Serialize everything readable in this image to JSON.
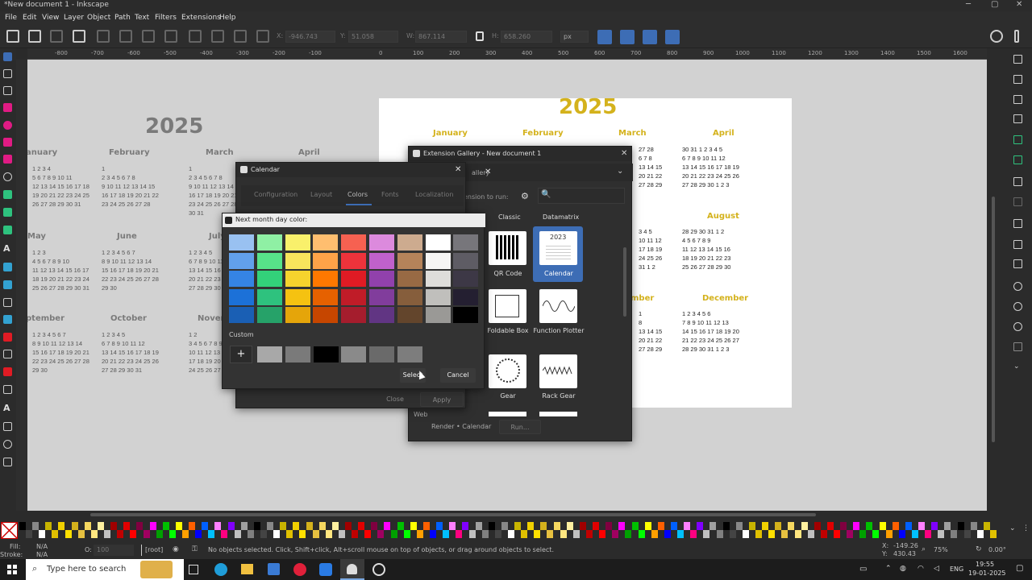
{
  "window": {
    "title": "*New document 1 - Inkscape",
    "controls": [
      "─",
      "▢",
      "✕"
    ]
  },
  "menu": [
    "File",
    "Edit",
    "View",
    "Layer",
    "Object",
    "Path",
    "Text",
    "Filters",
    "Extensions",
    "Help"
  ],
  "toolbar": {
    "x_label": "X:",
    "x_value": "-946.743",
    "y_label": "Y:",
    "y_value": "51.058",
    "w_label": "W:",
    "w_value": "867.114",
    "h_label": "H:",
    "h_value": "658.260",
    "unit": "px"
  },
  "ruler_ticks": [
    "-800",
    "-700",
    "-600",
    "-500",
    "-400",
    "-300",
    "-200",
    "-100",
    "0",
    "100",
    "200",
    "300",
    "400",
    "500",
    "600",
    "700",
    "800",
    "900",
    "1000",
    "1100",
    "1200",
    "1300",
    "1400",
    "1500",
    "1600"
  ],
  "canvas": {
    "gray_calendar": {
      "year": "2025",
      "months": [
        "anuary",
        "February",
        "March",
        "April",
        "May",
        "June",
        "July",
        "ptember",
        "October",
        "November"
      ]
    },
    "page_calendar": {
      "year": "2025",
      "months": [
        "January",
        "February",
        "March",
        "April",
        "August",
        "December",
        "mber"
      ]
    }
  },
  "calendar_dialog": {
    "title": "Calendar",
    "tabs": [
      "Configuration",
      "Layout",
      "Colors",
      "Fonts",
      "Localization"
    ],
    "active_tab": "Colors",
    "close_label": "Close",
    "apply_label": "Apply"
  },
  "color_picker": {
    "title": "Next month day color:",
    "custom_label": "Custom",
    "add_label": "+",
    "select_label": "Select",
    "cancel_label": "Cancel",
    "palette_columns": [
      [
        "#99c1f1",
        "#62a0ea",
        "#3584e4",
        "#1c71d8",
        "#1a5fb4"
      ],
      [
        "#8ff0a4",
        "#57e389",
        "#33d17a",
        "#2ec27e",
        "#26a269"
      ],
      [
        "#f9f06b",
        "#f8e45c",
        "#f6d32d",
        "#f5c211",
        "#e5a50a"
      ],
      [
        "#ffbe6f",
        "#ffa348",
        "#ff7800",
        "#e66100",
        "#c64600"
      ],
      [
        "#f66151",
        "#ed333b",
        "#e01b24",
        "#c01c28",
        "#a51d2d"
      ],
      [
        "#dc8add",
        "#c061cb",
        "#9141ac",
        "#813d9c",
        "#613583"
      ],
      [
        "#cdab8f",
        "#b5835a",
        "#986a44",
        "#865e3c",
        "#63452c"
      ],
      [
        "#ffffff",
        "#f6f5f4",
        "#deddda",
        "#c0bfbc",
        "#9a9996"
      ],
      [
        "#77767b",
        "#5e5c64",
        "#3d3846",
        "#241f31",
        "#000000"
      ]
    ],
    "custom_colors": [
      "#a8a8a8",
      "#7a7a7a",
      "#000000",
      "#8a8a8a",
      "#6a6a6a",
      "#7d7d7d"
    ]
  },
  "gallery_dialog": {
    "title": "Extension Gallery - New document 1",
    "tab_label": "allery",
    "search_hint": "ension to run:",
    "headers": [
      "Classic",
      "Datamatrix"
    ],
    "items": [
      {
        "label": "QR Code"
      },
      {
        "label": "Calendar",
        "sub": "2023"
      },
      {
        "label": "Foldable Box"
      },
      {
        "label": "Function Plotter"
      },
      {
        "label": "Gear"
      },
      {
        "label": "Rack Gear"
      }
    ],
    "left_item": "Web",
    "breadcrumb": "Render • Calendar",
    "run_label": "Run..."
  },
  "status": {
    "fill_label": "Fill:",
    "fill_value": "N/A",
    "stroke_label": "Stroke:",
    "stroke_value": "N/A",
    "opacity_label": "O:",
    "opacity_value": "100",
    "layer": "[root]",
    "message": "No objects selected. Click, Shift+click, Alt+scroll mouse on top of objects, or drag around objects to select.",
    "x_label": "X:",
    "x_value": "-149.26",
    "y_label": "Y:",
    "y_value": "430.43",
    "zoom_value": "75%",
    "rotation_value": "0.00°"
  },
  "taskbar": {
    "search_placeholder": "Type here to search",
    "language": "ENG",
    "time": "19:55",
    "date": "19-01-2025"
  },
  "colors": {
    "accent": "#3d6db5",
    "gold": "#d4b21c",
    "gray_text": "#7a7a7a"
  }
}
